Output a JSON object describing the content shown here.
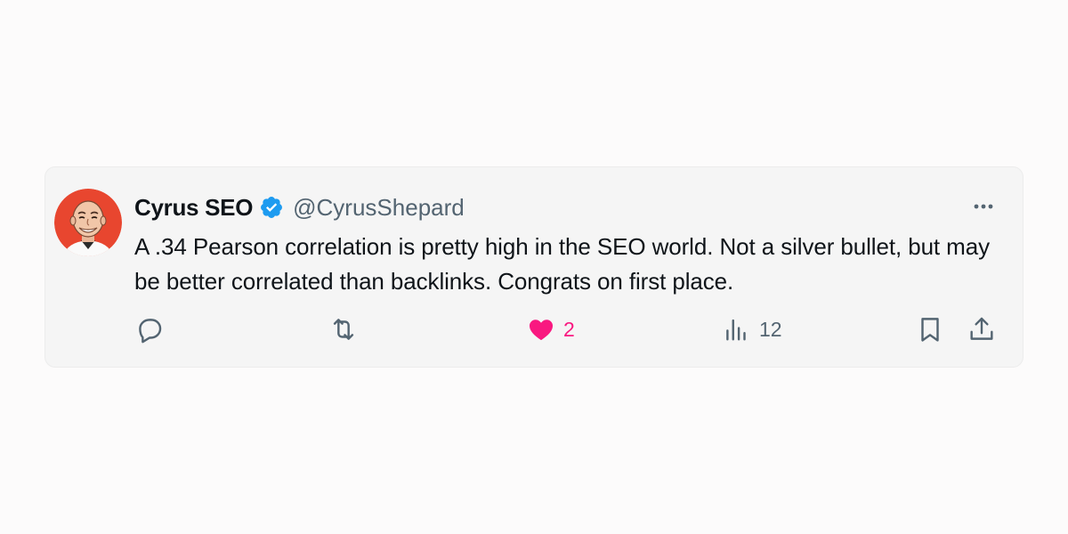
{
  "tweet": {
    "author": {
      "name": "Cyrus SEO",
      "handle": "@CyrusShepard",
      "verified": true,
      "verified_color": "#1d9bf0"
    },
    "text": "A .34 Pearson correlation is pretty high in the SEO world. Not a silver bullet, but may be better correlated than backlinks. Congrats on first place.",
    "actions": {
      "reply": {
        "icon": "reply-icon",
        "count": ""
      },
      "retweet": {
        "icon": "retweet-icon",
        "count": ""
      },
      "like": {
        "icon": "heart-icon",
        "count": "2",
        "liked": true,
        "color": "#f91880"
      },
      "views": {
        "icon": "views-icon",
        "count": "12"
      },
      "bookmark": {
        "icon": "bookmark-icon"
      },
      "share": {
        "icon": "share-icon"
      }
    },
    "more_icon": "more-icon"
  },
  "colors": {
    "card_bg": "#f5f5f5",
    "text_primary": "#0f1419",
    "text_secondary": "#536471",
    "avatar_bg": "#e8462f"
  }
}
